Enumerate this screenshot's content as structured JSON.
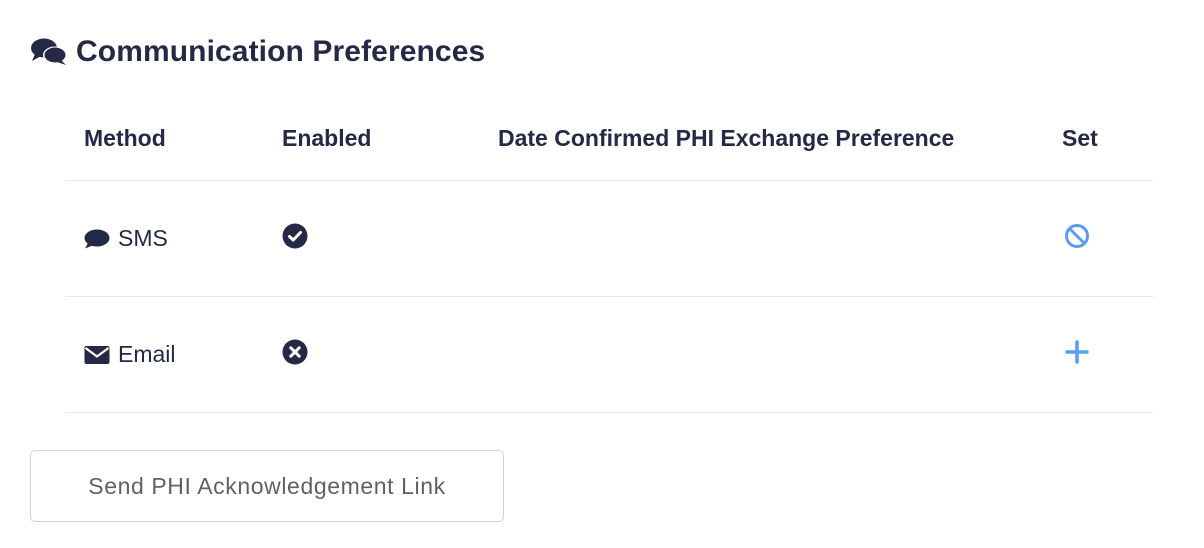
{
  "section": {
    "title": "Communication Preferences",
    "icon": "comments-icon"
  },
  "table": {
    "columns": [
      "Method",
      "Enabled",
      "Date Confirmed PHI Exchange Preference",
      "Set"
    ],
    "rows": [
      {
        "method": "SMS",
        "method_icon": "speech-bubble-icon",
        "enabled": true,
        "enabled_icon": "check-circle-icon",
        "date_confirmed": "",
        "set_action": "disable",
        "set_icon": "ban-icon"
      },
      {
        "method": "Email",
        "method_icon": "envelope-icon",
        "enabled": false,
        "enabled_icon": "x-circle-icon",
        "date_confirmed": "",
        "set_action": "add",
        "set_icon": "plus-icon"
      }
    ]
  },
  "send_button": {
    "label": "Send PHI Acknowledgement Link"
  },
  "colors": {
    "text": "#242a45",
    "accent": "#5b9cf0",
    "divider": "#e3e5e8",
    "button_border": "#cfd3d8",
    "button_text": "#5e6168"
  }
}
